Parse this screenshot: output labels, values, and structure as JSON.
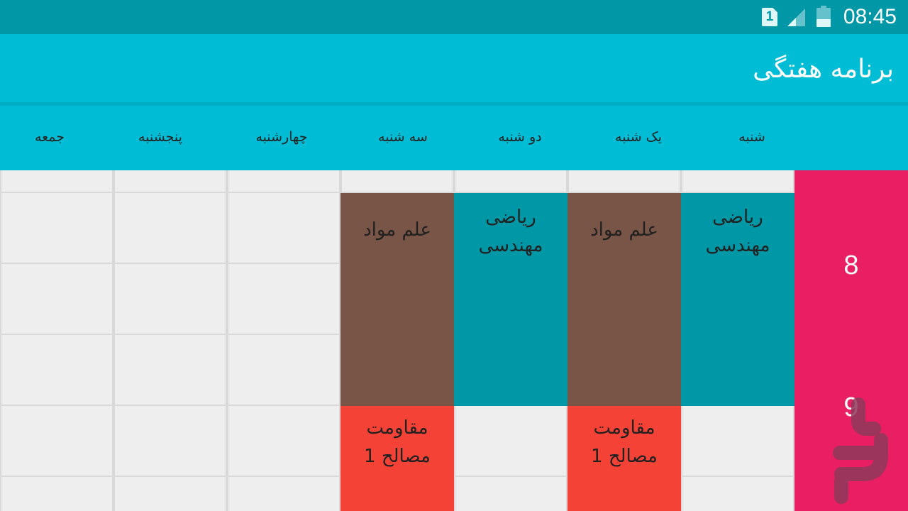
{
  "status_bar": {
    "time": "08:45",
    "sim_slot": "1",
    "icons": [
      "sim-icon",
      "signal-icon",
      "battery-icon"
    ]
  },
  "app_bar": {
    "title": "برنامه هفتگی"
  },
  "days": [
    "شنبه",
    "یک شنبه",
    "دو شنبه",
    "سه شنبه",
    "چهارشنبه",
    "پنجشنبه",
    "جمعه"
  ],
  "hours": [
    "8",
    "9"
  ],
  "courses": [
    {
      "day": "شنبه",
      "name": "ریاضی مهندسی",
      "color": "#0097a7"
    },
    {
      "day": "یک شنبه",
      "name": "علم مواد",
      "color": "#795548"
    },
    {
      "day": "یک شنبه",
      "name": "مقاومت مصالح 1",
      "color": "#f44336"
    },
    {
      "day": "دو شنبه",
      "name": "ریاضی مهندسی",
      "color": "#0097a7"
    },
    {
      "day": "سه شنبه",
      "name": "علم مواد",
      "color": "#795548"
    },
    {
      "day": "سه شنبه",
      "name": "مقاومت مصالح 1",
      "color": "#f44336"
    }
  ],
  "colors": {
    "status_bar": "#0097a7",
    "app_bar": "#00bcd4",
    "hour_column": "#e91e63",
    "grid_background": "#eeeeee"
  }
}
